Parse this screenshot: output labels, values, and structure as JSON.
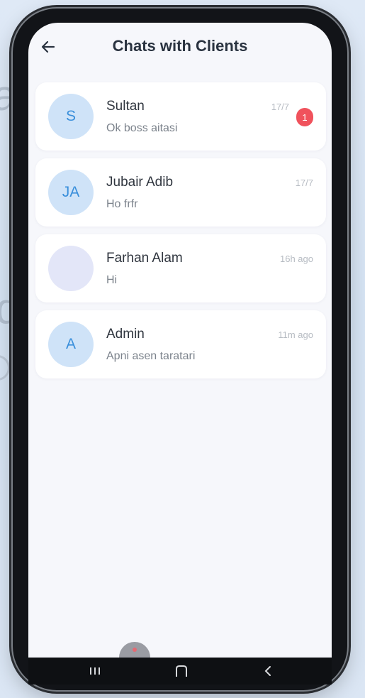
{
  "header": {
    "title": "Chats with Clients",
    "back_icon": "arrow-left-icon"
  },
  "chats": [
    {
      "initials": "S",
      "name": "Sultan",
      "preview": "Ok boss aitasi",
      "time": "17/7",
      "unread": "1"
    },
    {
      "initials": "JA",
      "name": "Jubair Adib",
      "preview": "Ho frfr",
      "time": "17/7"
    },
    {
      "initials": "",
      "name": "Farhan Alam",
      "preview": "Hi",
      "time": "16h ago"
    },
    {
      "initials": "A",
      "name": "Admin",
      "preview": "Apni asen taratari",
      "time": "11m ago"
    }
  ],
  "colors": {
    "avatar_bg": "#cfe3f8",
    "avatar_text": "#3a8fdb",
    "badge": "#f0525c",
    "screen_bg": "#f6f7fb"
  },
  "nav": {
    "recent_icon": "recent-apps-icon",
    "home_icon": "home-icon",
    "back_icon": "nav-back-icon"
  }
}
